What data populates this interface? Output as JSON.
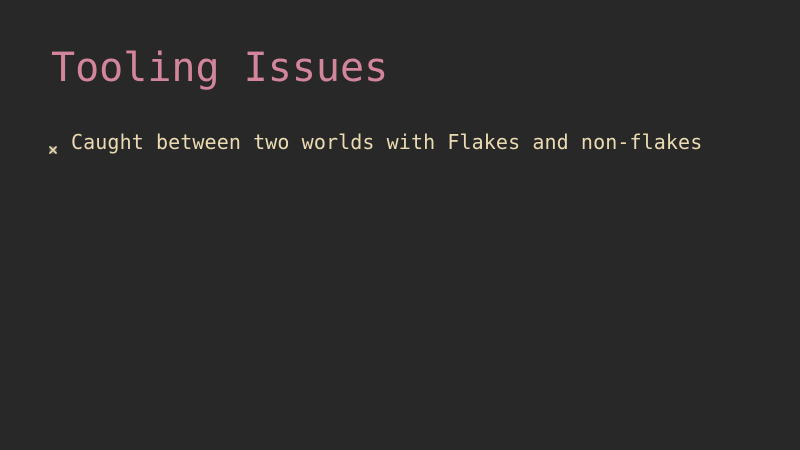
{
  "slide": {
    "title": "Tooling Issues",
    "bullets": [
      {
        "icon": "x-bullet-icon",
        "text": "Caught between two worlds with Flakes and non-flakes"
      }
    ]
  },
  "colors": {
    "background": "#282828",
    "title": "#d3869b",
    "body_text": "#ebdbb2",
    "bullet": "#ebdbb2"
  }
}
